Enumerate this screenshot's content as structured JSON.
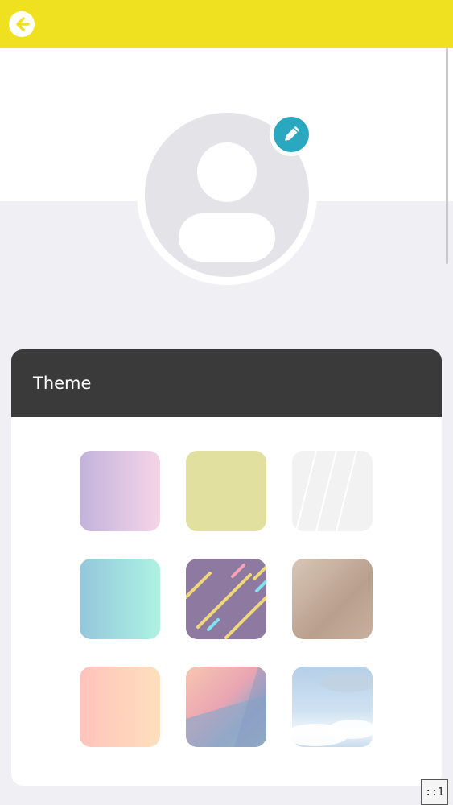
{
  "header": {
    "back_icon": "back-arrow-icon",
    "bar_color": "#efe11f"
  },
  "profile": {
    "avatar_icon": "default-user-avatar-icon",
    "edit_icon": "pencil-icon",
    "edit_color": "#29a8bf"
  },
  "theme_card": {
    "title": "Theme",
    "swatches": [
      {
        "name": "lavender-pink-gradient"
      },
      {
        "name": "olive-yellow"
      },
      {
        "name": "light-gray-stripes"
      },
      {
        "name": "blue-mint-gradient"
      },
      {
        "name": "purple-confetti-lines"
      },
      {
        "name": "wood-texture"
      },
      {
        "name": "peach-gradient"
      },
      {
        "name": "pastel-geometric"
      },
      {
        "name": "sky-clouds"
      }
    ]
  },
  "badge": {
    "text": "::1"
  }
}
